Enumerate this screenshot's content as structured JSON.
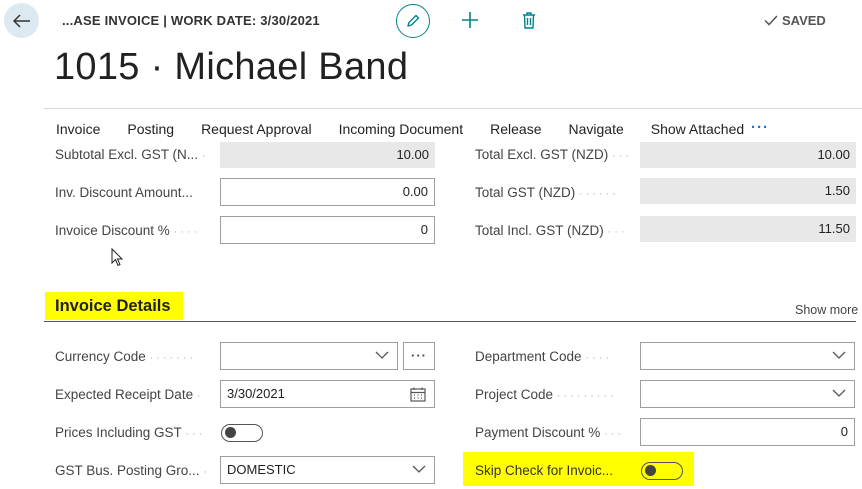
{
  "header": {
    "caption": "...ASE INVOICE | WORK DATE: 3/30/2021",
    "saved_label": "SAVED",
    "title": "1015 · Michael Band"
  },
  "actions": [
    "Invoice",
    "Posting",
    "Request Approval",
    "Incoming Document",
    "Release",
    "Navigate",
    "Show Attached"
  ],
  "more_label": "···",
  "totals": {
    "left": [
      {
        "label": "Subtotal Excl. GST (N...",
        "value": "10.00",
        "editable": false
      },
      {
        "label": "Inv. Discount Amount...",
        "value": "0.00",
        "editable": true
      },
      {
        "label": "Invoice Discount %",
        "value": "0",
        "editable": true
      }
    ],
    "right": [
      {
        "label": "Total Excl. GST (NZD)",
        "value": "10.00"
      },
      {
        "label": "Total GST (NZD)",
        "value": "1.50"
      },
      {
        "label": "Total Incl. GST (NZD)",
        "value": "11.50"
      }
    ]
  },
  "invoice_details": {
    "title": "Invoice Details",
    "show_more": "Show more",
    "currency_code": {
      "label": "Currency Code",
      "value": ""
    },
    "expected_receipt_date": {
      "label": "Expected Receipt Date",
      "value": "3/30/2021"
    },
    "prices_including_gst": {
      "label": "Prices Including GST",
      "value": false
    },
    "gst_bus_posting_group": {
      "label": "GST Bus. Posting Gro...",
      "value": "DOMESTIC"
    },
    "department_code": {
      "label": "Department Code",
      "value": ""
    },
    "project_code": {
      "label": "Project Code",
      "value": ""
    },
    "payment_discount": {
      "label": "Payment Discount %",
      "value": "0"
    },
    "skip_check": {
      "label": "Skip Check for Invoic...",
      "value": false
    }
  },
  "colors": {
    "accent": "#008489",
    "highlight": "#ffff00",
    "link": "#1f70c1"
  }
}
